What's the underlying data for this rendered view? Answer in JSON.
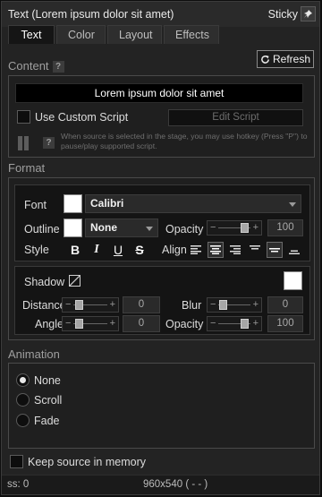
{
  "window": {
    "title": "Text (Lorem ipsum dolor sit amet)",
    "sticky_label": "Sticky"
  },
  "tabs": [
    {
      "label": "Text",
      "active": true
    },
    {
      "label": "Color",
      "active": false
    },
    {
      "label": "Layout",
      "active": false
    },
    {
      "label": "Effects",
      "active": false
    }
  ],
  "content": {
    "header": "Content",
    "help_glyph": "?",
    "refresh_label": "Refresh",
    "text_value": "Lorem ipsum dolor sit amet",
    "use_custom_script_label": "Use Custom Script",
    "use_custom_script_checked": false,
    "edit_script_label": "Edit Script",
    "note": "When source is selected in the stage, you may use hotkey (Press \"P\") to pause/play supported script."
  },
  "format": {
    "header": "Format",
    "font_label": "Font",
    "font_value": "Calibri",
    "font_color": "#ffffff",
    "outline_label": "Outline",
    "outline_value": "None",
    "outline_color": "#ffffff",
    "opacity_label": "Opacity",
    "opacity_value": "100",
    "style_label": "Style",
    "style_buttons": {
      "bold": "B",
      "italic": "I",
      "underline": "U",
      "strike": "S"
    },
    "align_label": "Align",
    "align_selected": "center",
    "shadow_label": "Shadow",
    "shadow_color": "#ffffff",
    "distance_label": "Distance",
    "distance_value": "0",
    "blur_label": "Blur",
    "blur_value": "0",
    "angle_label": "Angle",
    "angle_value": "0",
    "shadow_opacity_label": "Opacity",
    "shadow_opacity_value": "100"
  },
  "animation": {
    "header": "Animation",
    "options": [
      {
        "label": "None",
        "checked": true
      },
      {
        "label": "Scroll",
        "checked": false
      },
      {
        "label": "Fade",
        "checked": false
      }
    ],
    "keep_in_memory_label": "Keep source in memory",
    "keep_in_memory_checked": false
  },
  "status": {
    "left": "ss: 0",
    "center": "960x540 ( - - )"
  }
}
